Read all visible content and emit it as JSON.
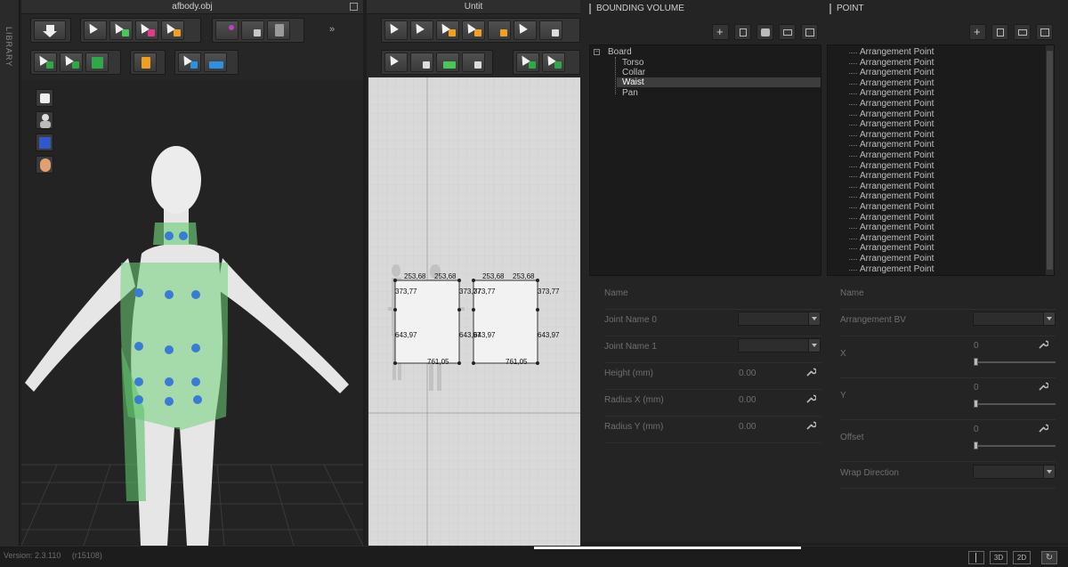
{
  "library": {
    "label": "LIBRARY"
  },
  "window3d": {
    "title": "afbody.obj"
  },
  "window2d": {
    "title": "Untit"
  },
  "viewport2d": {
    "labels": [
      {
        "id": "top-a",
        "text": "253,68"
      },
      {
        "id": "top-b",
        "text": "253,68"
      },
      {
        "id": "top-c",
        "text": "253,68"
      },
      {
        "id": "top-d",
        "text": "253,68"
      },
      {
        "id": "mid1-a",
        "text": "373,77"
      },
      {
        "id": "mid1-b",
        "text": "373,77"
      },
      {
        "id": "mid1-c",
        "text": "373,77"
      },
      {
        "id": "mid1-d",
        "text": "373,77"
      },
      {
        "id": "mid2-a",
        "text": "643,97"
      },
      {
        "id": "mid2-b",
        "text": "643,97"
      },
      {
        "id": "mid2-c",
        "text": "643,97"
      },
      {
        "id": "mid2-d",
        "text": "643,97"
      },
      {
        "id": "bot-a",
        "text": "761,05"
      },
      {
        "id": "bot-b",
        "text": "761,05"
      }
    ]
  },
  "bounding_volume": {
    "title": "BOUNDING VOLUME",
    "tree": {
      "root": "Board",
      "children": [
        "Torso",
        "Collar",
        "Waist",
        "Pan"
      ],
      "selected": "Waist"
    },
    "properties": {
      "name_label": "Name",
      "joint0_label": "Joint Name 0",
      "joint1_label": "Joint Name 1",
      "height_label": "Height (mm)",
      "height_value": "0.00",
      "radius_x_label": "Radius X (mm)",
      "radius_x_value": "0.00",
      "radius_y_label": "Radius Y (mm)",
      "radius_y_value": "0.00"
    }
  },
  "point": {
    "title": "POINT",
    "items": [
      "Arrangement Point",
      "Arrangement Point",
      "Arrangement Point",
      "Arrangement Point",
      "Arrangement Point",
      "Arrangement Point",
      "Arrangement Point",
      "Arrangement Point",
      "Arrangement Point",
      "Arrangement Point",
      "Arrangement Point",
      "Arrangement Point",
      "Arrangement Point",
      "Arrangement Point",
      "Arrangement Point",
      "Arrangement Point",
      "Arrangement Point",
      "Arrangement Point",
      "Arrangement Point",
      "Arrangement Point",
      "Arrangement Point",
      "Arrangement Point"
    ],
    "properties": {
      "name_label": "Name",
      "arrangement_bv_label": "Arrangement BV",
      "x_label": "X",
      "x_value": "0",
      "y_label": "Y",
      "y_value": "0",
      "offset_label": "Offset",
      "offset_value": "0",
      "wrap_label": "Wrap Direction"
    }
  },
  "status": {
    "version": "Version: 2.3.110",
    "revision": "(r15108)",
    "btn_3d": "3D",
    "btn_2d": "2D"
  },
  "colors": {
    "body": "#e6e6e6",
    "volume": "#6fd07a",
    "points": "#3a7bd5",
    "accent_green": "#49c85a",
    "accent_orange": "#f0a020",
    "accent_magenta": "#e03a8a"
  }
}
